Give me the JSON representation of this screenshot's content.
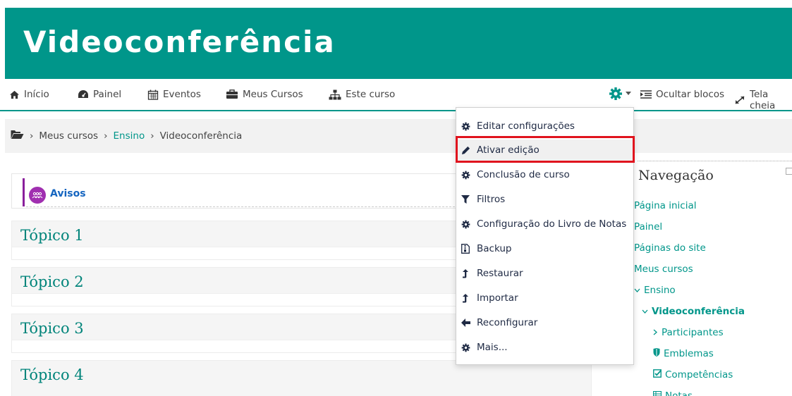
{
  "banner": {
    "title": "Videoconferência"
  },
  "navbar": {
    "items": [
      {
        "label": "Início",
        "icon": "home-icon"
      },
      {
        "label": "Painel",
        "icon": "dashboard-icon"
      },
      {
        "label": "Eventos",
        "icon": "calendar-icon"
      },
      {
        "label": "Meus Cursos",
        "icon": "briefcase-icon"
      },
      {
        "label": "Este curso",
        "icon": "sitemap-icon"
      }
    ],
    "settings_icon": "gear-icon",
    "hide_blocks": "Ocultar blocos",
    "fullscreen": "Tela cheia"
  },
  "breadcrumb": {
    "items": [
      "Meus cursos",
      "Ensino",
      "Videoconferência"
    ],
    "separator": "›"
  },
  "main": {
    "avisos": "Avisos",
    "topics": [
      "Tópico 1",
      "Tópico 2",
      "Tópico 3",
      "Tópico 4"
    ]
  },
  "dropdown": {
    "items": [
      {
        "label": "Editar configurações",
        "icon": "gear-icon"
      },
      {
        "label": "Ativar edição",
        "icon": "pencil-icon"
      },
      {
        "label": "Conclusão de curso",
        "icon": "gear-icon"
      },
      {
        "label": "Filtros",
        "icon": "filter-icon"
      },
      {
        "label": "Configuração do Livro de Notas",
        "icon": "gear-icon"
      },
      {
        "label": "Backup",
        "icon": "file-archive-icon"
      },
      {
        "label": "Restaurar",
        "icon": "upload-arrow-icon"
      },
      {
        "label": "Importar",
        "icon": "upload-arrow-icon"
      },
      {
        "label": "Reconfigurar",
        "icon": "arrow-left-icon"
      },
      {
        "label": "Mais...",
        "icon": "gear-icon"
      }
    ],
    "highlighted": "Ativar edição"
  },
  "navigation_block": {
    "title": "Navegação",
    "items": [
      {
        "label": "Página inicial"
      },
      {
        "label": "Painel"
      },
      {
        "label": "Páginas do site"
      },
      {
        "label": "Meus cursos"
      },
      {
        "label": "Ensino"
      },
      {
        "label": "Videoconferência"
      },
      {
        "label": "Participantes"
      },
      {
        "label": "Emblemas"
      },
      {
        "label": "Competências"
      },
      {
        "label": "Notas"
      }
    ]
  },
  "colors": {
    "brand": "#00968a",
    "link": "#00968a",
    "highlight_border": "#e0141e",
    "avisos_accent": "#a02fb0"
  }
}
